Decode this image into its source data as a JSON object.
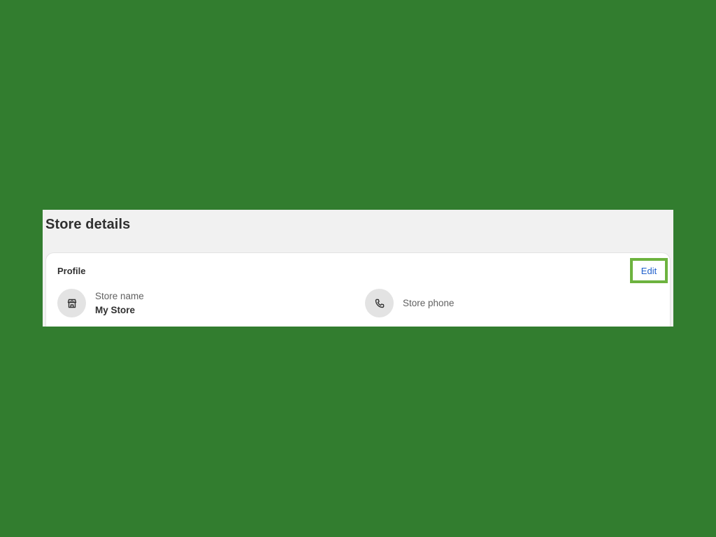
{
  "page": {
    "title": "Store details"
  },
  "profile_card": {
    "title": "Profile",
    "edit_label": "Edit",
    "store_name": {
      "label": "Store name",
      "value": "My Store",
      "icon": "store-icon"
    },
    "store_phone": {
      "label": "Store phone",
      "icon": "phone-icon"
    }
  },
  "colors": {
    "backdrop": "#327d2f",
    "panel": "#f1f1f1",
    "highlight": "#6db33f",
    "link": "#1f5fcc"
  }
}
